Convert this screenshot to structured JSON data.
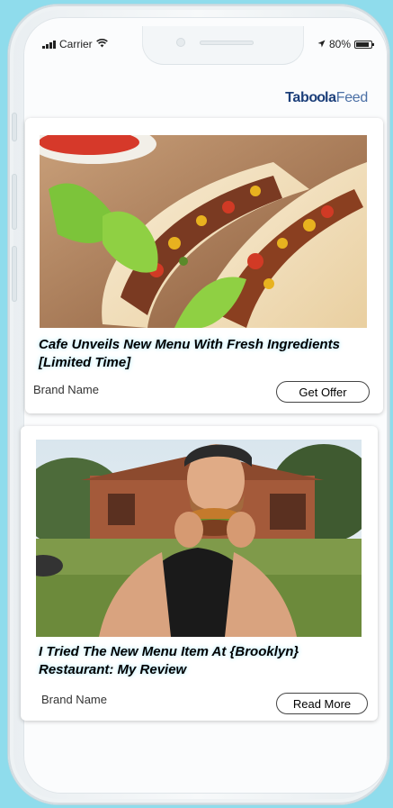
{
  "status_bar": {
    "carrier": "Carrier",
    "battery_percent": "80%"
  },
  "brand_logo": {
    "part1": "Tab",
    "part2": "oo",
    "part3": "la",
    "part4": "Feed"
  },
  "cards": [
    {
      "headline": "Cafe Unveils New Menu With Fresh Ingredients [Limited Time]",
      "brand": "Brand Name",
      "cta": "Get Offer",
      "image": "tacos-photo"
    },
    {
      "headline": "I Tried The New Menu Item At {Brooklyn} Restaurant:  My Review",
      "brand": "Brand Name",
      "cta": "Read More",
      "image": "man-eating-burger-photo"
    }
  ],
  "colors": {
    "background": "#8fdcec",
    "logo": "#1c3f7a"
  }
}
